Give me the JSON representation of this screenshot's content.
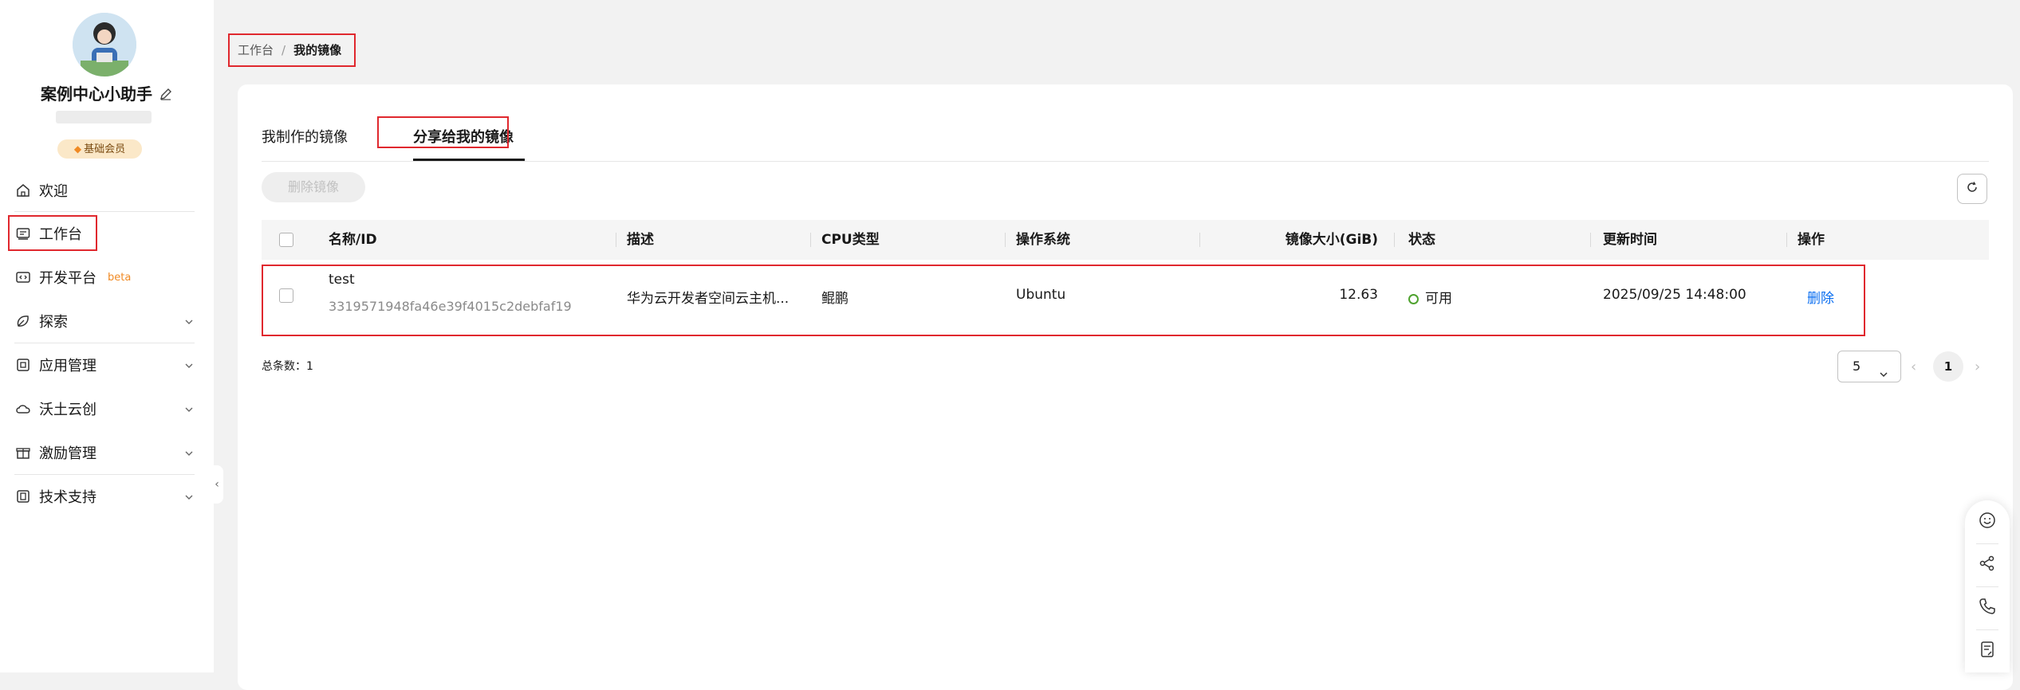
{
  "sidebar": {
    "user_name": "案例中心小助手",
    "member_badge": "基础会员",
    "items": [
      {
        "label": "欢迎",
        "icon": "home-icon"
      },
      {
        "label": "工作台",
        "icon": "workbench-icon"
      },
      {
        "label": "开发平台",
        "icon": "dev-platform-icon",
        "badge": "beta"
      },
      {
        "label": "探索",
        "icon": "explore-icon"
      },
      {
        "label": "应用管理",
        "icon": "app-management-icon"
      },
      {
        "label": "沃土云创",
        "icon": "cloud-create-icon"
      },
      {
        "label": "激励管理",
        "icon": "gift-icon"
      },
      {
        "label": "技术支持",
        "icon": "support-icon"
      }
    ]
  },
  "breadcrumb": {
    "parent": "工作台",
    "separator": "/",
    "current": "我的镜像"
  },
  "tabs": [
    {
      "label": "我制作的镜像",
      "active": false
    },
    {
      "label": "分享给我的镜像",
      "active": true
    }
  ],
  "toolbar": {
    "delete_label": "删除镜像"
  },
  "table": {
    "columns": [
      "名称/ID",
      "描述",
      "CPU类型",
      "操作系统",
      "镜像大小(GiB)",
      "状态",
      "更新时间",
      "操作"
    ],
    "rows": [
      {
        "name": "test",
        "id": "3319571948fa46e39f4015c2debfaf19",
        "description": "华为云开发者空间云主机...",
        "cpu_type": "鲲鹏",
        "os": "Ubuntu",
        "size": "12.63",
        "status": "可用",
        "updated": "2025/09/25 14:48:00",
        "action": "删除"
      }
    ]
  },
  "pagination": {
    "total_label": "总条数：1",
    "page_size": "5",
    "current_page": "1"
  },
  "colors": {
    "accent": "#0a6ef0",
    "highlight_box": "#e0282e",
    "status_ok": "#4ea22e",
    "beta": "#f08a24"
  }
}
